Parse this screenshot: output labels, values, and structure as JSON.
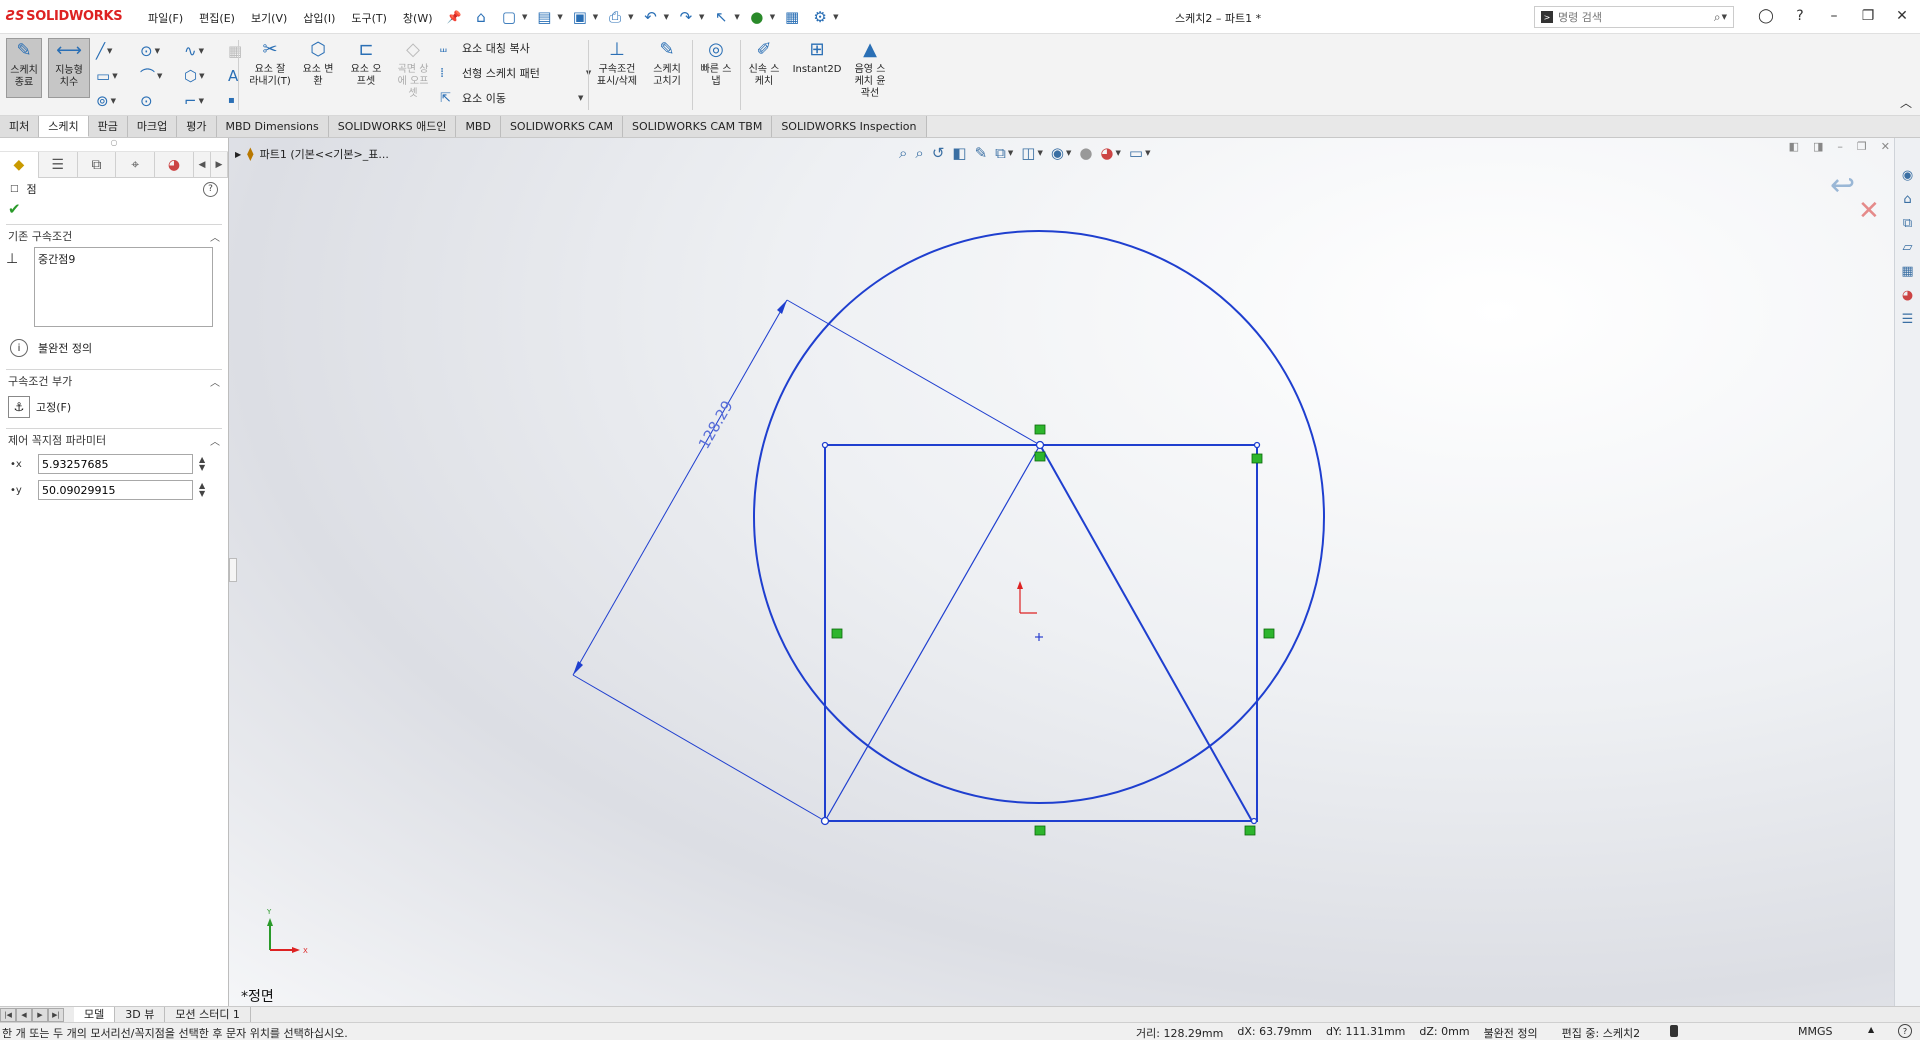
{
  "app": {
    "logo_text": "SOLIDWORKS",
    "doc_title": "스케치2 – 파트1 *"
  },
  "menu": [
    "파일(F)",
    "편집(E)",
    "보기(V)",
    "삽입(I)",
    "도구(T)",
    "창(W)"
  ],
  "search": {
    "placeholder": "명령 검색"
  },
  "ribbon": {
    "exit_sketch": "스케치\n종료",
    "smart_dim": "지능형\n치수",
    "trim": "요소 잘\n라내기(T)",
    "convert": "요소 변\n환",
    "offset": "요소 오\n프셋",
    "surface_offset": "곡면 상\n에 오프\n셋",
    "mirror": "요소 대칭 복사",
    "linear_pattern": "선형 스케치 패턴",
    "move": "요소 이동",
    "display_relations": "구속조건\n표시/삭제",
    "repair": "스케치\n고치기",
    "quick_snaps": "빠른 스\n냅",
    "rapid_sketch": "신속 스\n케치",
    "instant2d": "Instant2D",
    "shaded_contours": "음영 스\n케치 윤\n곽선"
  },
  "tabs": [
    "피처",
    "스케치",
    "판금",
    "마크업",
    "평가",
    "MBD Dimensions",
    "SOLIDWORKS 애드인",
    "MBD",
    "SOLIDWORKS CAM",
    "SOLIDWORKS CAM TBM",
    "SOLIDWORKS Inspection"
  ],
  "active_tab": "스케치",
  "property_manager": {
    "title": "점",
    "existing_relations_title": "기존 구속조건",
    "existing_relations": [
      "중간점9"
    ],
    "status": "불완전 정의",
    "add_relations_title": "구속조건 부가",
    "fix_label": "고정(F)",
    "parameters_title": "제어 꼭지점 파라미터",
    "x_value": "5.93257685",
    "y_value": "50.09029915"
  },
  "graphics": {
    "breadcrumb": "파트1  (기본<<기본>_표...",
    "view_label": "*정면",
    "dimension_value": "128.29",
    "sketch_color": "#1f3fcf",
    "relation_color": "#2db52d"
  },
  "model_tabs": [
    "모델",
    "3D 뷰",
    "모션 스터디 1"
  ],
  "status": {
    "message": "한 개 또는 두 개의 모서리선/꼭지점을 선택한 후 문자 위치를 선택하십시오.",
    "distance": "거리: 128.29mm",
    "dx": "dX: 63.79mm",
    "dy": "dY: 111.31mm",
    "dz": "dZ: 0mm",
    "definition": "불완전 정의",
    "editing": "편집 중: 스케치2",
    "units": "MMGS"
  }
}
